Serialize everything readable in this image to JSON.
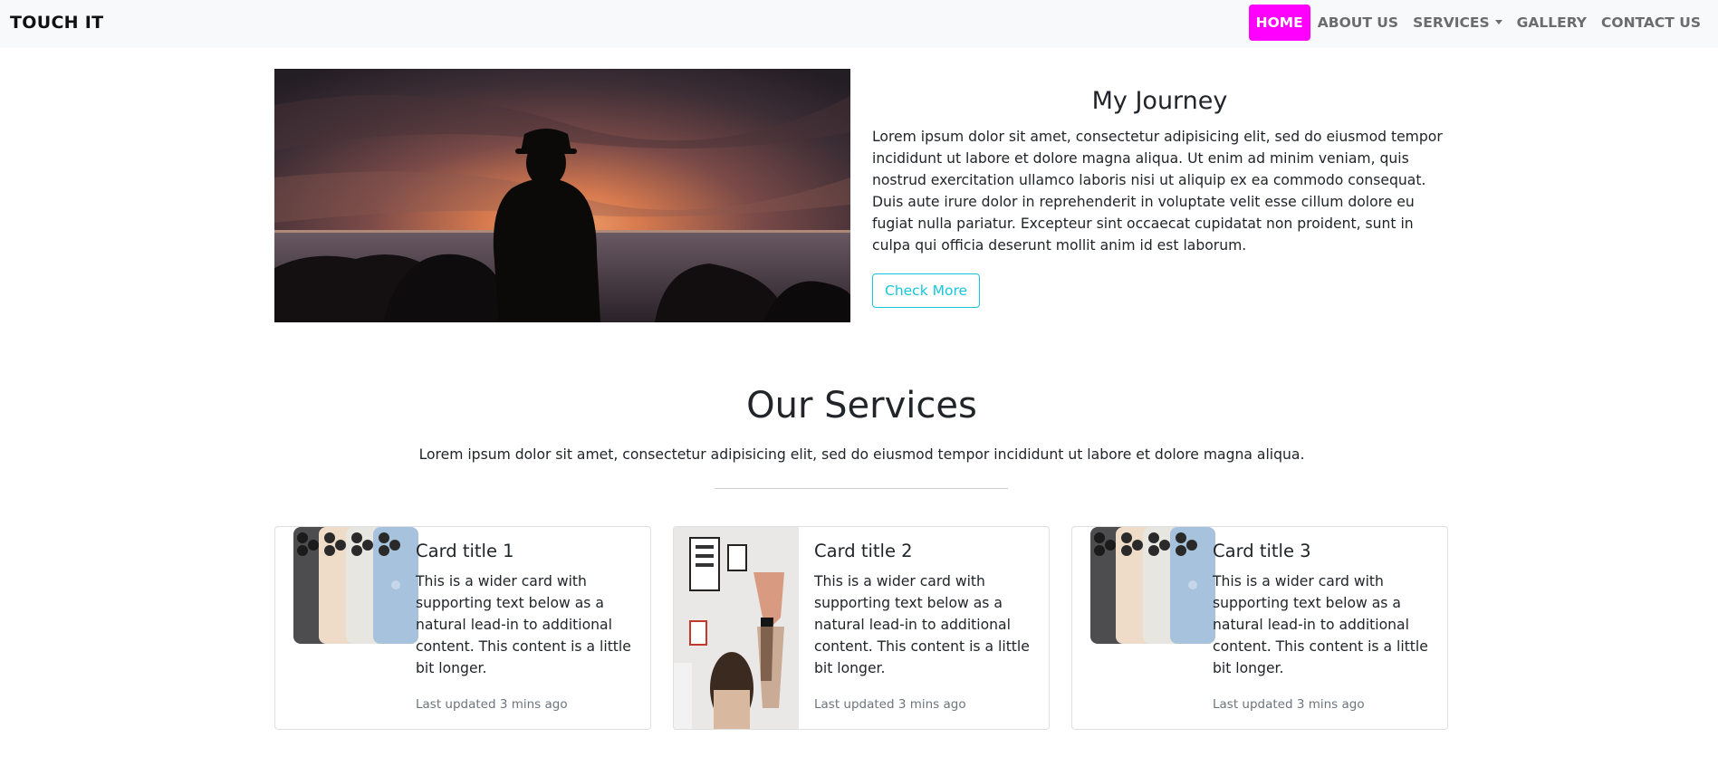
{
  "navbar": {
    "brand": "TOUCH IT",
    "links": [
      {
        "label": "HOME"
      },
      {
        "label": "ABOUT US"
      },
      {
        "label": "SERVICES"
      },
      {
        "label": "GALLERY"
      },
      {
        "label": "CONTACT US"
      }
    ],
    "active_color": "#ff00ff"
  },
  "hero": {
    "title": "My Journey",
    "body": "Lorem ipsum dolor sit amet, consectetur adipisicing elit, sed do eiusmod tempor incididunt ut labore et dolore magna aliqua. Ut enim ad minim veniam, quis nostrud exercitation ullamco laboris nisi ut aliquip ex ea commodo consequat. Duis aute irure dolor in reprehenderit in voluptate velit esse cillum dolore eu fugiat nulla pariatur. Excepteur sint occaecat cupidatat non proident, sunt in culpa qui officia deserunt mollit anim id est laborum.",
    "button_label": "Check More",
    "button_color": "#17c6dc"
  },
  "services": {
    "title": "Our Services",
    "subtitle": "Lorem ipsum dolor sit amet, consectetur adipisicing elit, sed do eiusmod tempor incididunt ut labore et dolore magna aliqua.",
    "cards": [
      {
        "title": "Card title 1",
        "text": "This is a wider card with supporting text below as a natural lead-in to additional content. This content is a little bit longer.",
        "meta": "Last updated 3 mins ago"
      },
      {
        "title": "Card title 2",
        "text": "This is a wider card with supporting text below as a natural lead-in to additional content. This content is a little bit longer.",
        "meta": "Last updated 3 mins ago"
      },
      {
        "title": "Card title 3",
        "text": "This is a wider card with supporting text below as a natural lead-in to additional content. This content is a little bit longer.",
        "meta": "Last updated 3 mins ago"
      }
    ]
  }
}
